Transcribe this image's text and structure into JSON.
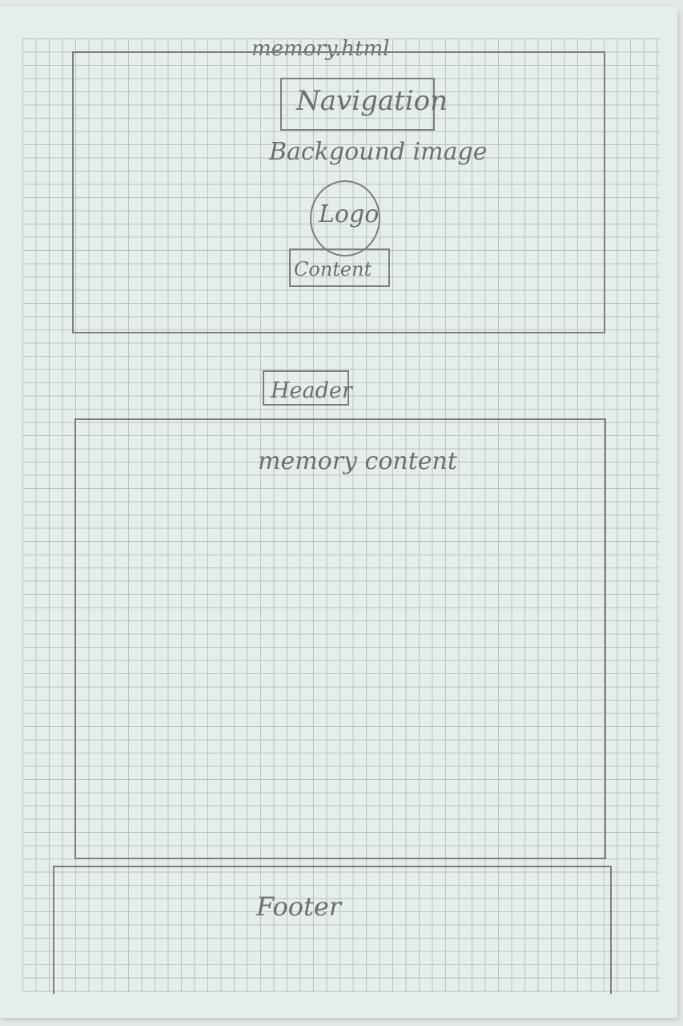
{
  "sketch": {
    "page_title": "memory.html",
    "top_section": {
      "navigation_label": "Navigation",
      "background_label": "Backgound image",
      "logo_label": "Logo",
      "content_label": "Content"
    },
    "header_label": "Header",
    "memory_content_label": "memory content",
    "footer_label": "Footer"
  }
}
